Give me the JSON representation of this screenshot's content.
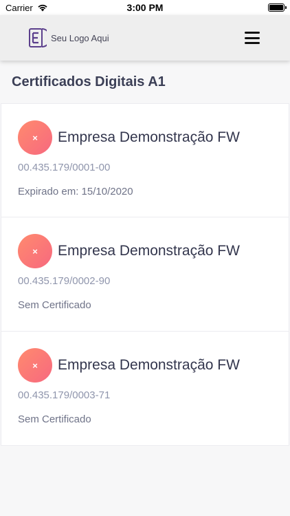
{
  "status_bar": {
    "carrier": "Carrier",
    "time": "3:00 PM"
  },
  "header": {
    "logo_text": "Seu Logo Aqui"
  },
  "page": {
    "title": "Certificados Digitais A1"
  },
  "companies": [
    {
      "name": "Empresa Demonstração FW",
      "cnpj": "00.435.179/0001-00",
      "status": "Expirado em: 15/10/2020",
      "icon": "close-icon",
      "status_icon_symbol": "×"
    },
    {
      "name": "Empresa Demonstração FW",
      "cnpj": "00.435.179/0002-90",
      "status": "Sem Certificado",
      "icon": "close-icon",
      "status_icon_symbol": "×"
    },
    {
      "name": "Empresa Demonstração FW",
      "cnpj": "00.435.179/0003-71",
      "status": "Sem Certificado",
      "icon": "close-icon",
      "status_icon_symbol": "×"
    }
  ],
  "colors": {
    "accent_gradient_start": "#ff8a6e",
    "accent_gradient_end": "#f7697f",
    "logo": "#5b3f8c"
  }
}
